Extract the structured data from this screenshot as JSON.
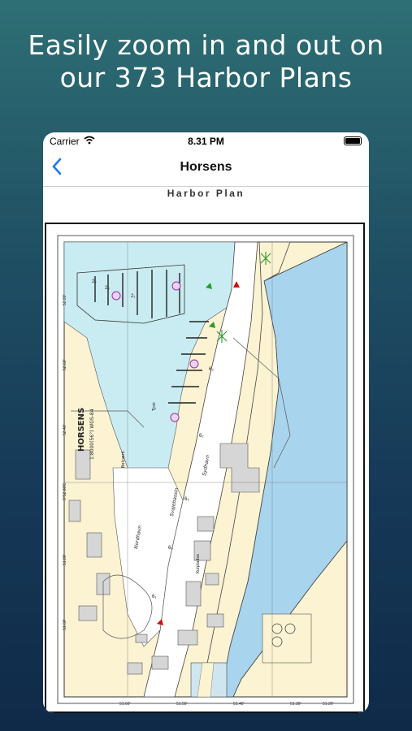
{
  "headline": {
    "line1": "Easily zoom in and out on",
    "line2": "our 373 Harbor Plans"
  },
  "status_bar": {
    "carrier": "Carrier",
    "time": "8.31 PM"
  },
  "nav": {
    "back_icon": "chevron-left-icon",
    "title": "Horsens"
  },
  "section_title": "Harbor Plan",
  "harbor_map": {
    "title": "HORSENS",
    "scale": "1:8000(56°) WGS-84",
    "labels": {
      "sydhavn": "Sydhavn",
      "nordhavn": "Nordhavn",
      "svajebassin": "Svajebassin",
      "bolvaerk": "Bolværk",
      "kulpladse": "Kulpladse",
      "tysk": "Tysk"
    },
    "lat_labels": [
      "51.60'",
      "51.50'",
      "51.40'",
      "51.30'",
      "51.20'"
    ],
    "lon_labels": [
      "52.80'",
      "52.60'",
      "52.40'",
      "52.20'",
      "9°52.00'E",
      "51.80'",
      "51.60'"
    ],
    "depths": [
      "2₂",
      "2₃",
      "2₁",
      "6₃",
      "6₂",
      "6₄",
      "6₅",
      "6₁"
    ],
    "colors": {
      "water": "#c9ecf2",
      "land": "#fbf3d2",
      "deep_water": "#a9d4ee",
      "building": "#d6d6d6"
    }
  }
}
